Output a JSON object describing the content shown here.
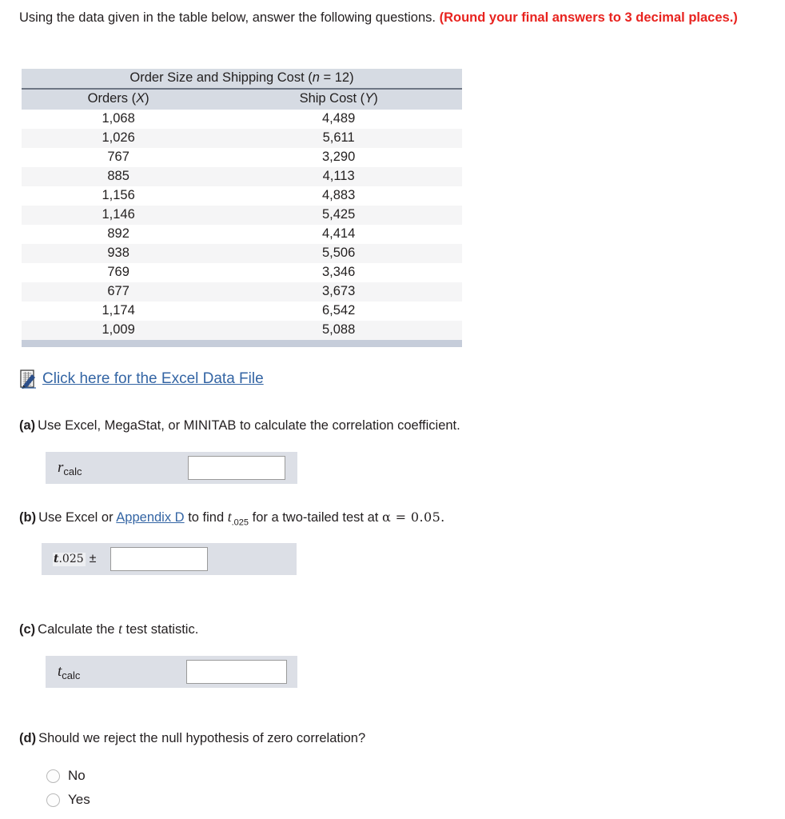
{
  "intro": {
    "text_plain": "Using the data given in the table below, answer the following questions. ",
    "text_emph": "(Round your final answers to 3 decimal places.)"
  },
  "table": {
    "title_text": "Order Size and Shipping Cost (",
    "title_var": "n",
    "title_eq": " = 12)",
    "columns": [
      {
        "label": "Orders (",
        "var": "X",
        "close": ")"
      },
      {
        "label": "Ship Cost (",
        "var": "Y",
        "close": ")"
      }
    ],
    "rows": [
      {
        "orders": "1,068",
        "ship_cost": "4,489"
      },
      {
        "orders": "1,026",
        "ship_cost": "5,611"
      },
      {
        "orders": "767",
        "ship_cost": "3,290"
      },
      {
        "orders": "885",
        "ship_cost": "4,113"
      },
      {
        "orders": "1,156",
        "ship_cost": "4,883"
      },
      {
        "orders": "1,146",
        "ship_cost": "5,425"
      },
      {
        "orders": "892",
        "ship_cost": "4,414"
      },
      {
        "orders": "938",
        "ship_cost": "5,506"
      },
      {
        "orders": "769",
        "ship_cost": "3,346"
      },
      {
        "orders": "677",
        "ship_cost": "3,673"
      },
      {
        "orders": "1,174",
        "ship_cost": "6,542"
      },
      {
        "orders": "1,009",
        "ship_cost": "5,088"
      }
    ]
  },
  "excel_link": {
    "label": "Click here for the Excel Data File",
    "icon": "excel-data-file-icon",
    "color": "#3465a4"
  },
  "questions": {
    "a": {
      "label": "(a)",
      "text": "Use Excel, MegaStat, or MINITAB to calculate the correlation coefficient.",
      "answer_var": "r",
      "answer_sub": "calc",
      "answer_value": ""
    },
    "b": {
      "label": "(b)",
      "text_1": "Use Excel or ",
      "link": "Appendix D",
      "text_2": " to find ",
      "t_var": "t",
      "t_sub": ".025",
      "text_3": " for a two-tailed test at ",
      "alpha_expr": "α = 0.05.",
      "answer_var": "t",
      "answer_sub": ".025",
      "answer_pm": "±",
      "answer_value": ""
    },
    "c": {
      "label": "(c)",
      "text_1": "Calculate the ",
      "t_var": "t",
      "text_2": " test statistic.",
      "answer_var": "t",
      "answer_sub": "calc",
      "answer_value": ""
    },
    "d": {
      "label": "(d)",
      "text": "Should we reject the null hypothesis of zero correlation?",
      "options": [
        {
          "label": "No",
          "selected": false
        },
        {
          "label": "Yes",
          "selected": false
        }
      ]
    }
  },
  "colors": {
    "emphasis_red": "#e8231f",
    "link_blue": "#3465a4",
    "table_header_bg": "#d6dbe3",
    "table_footer_bg": "#c6cdda",
    "row_stripe": "#f5f5f6",
    "panel_bg": "#dcdfe6"
  }
}
